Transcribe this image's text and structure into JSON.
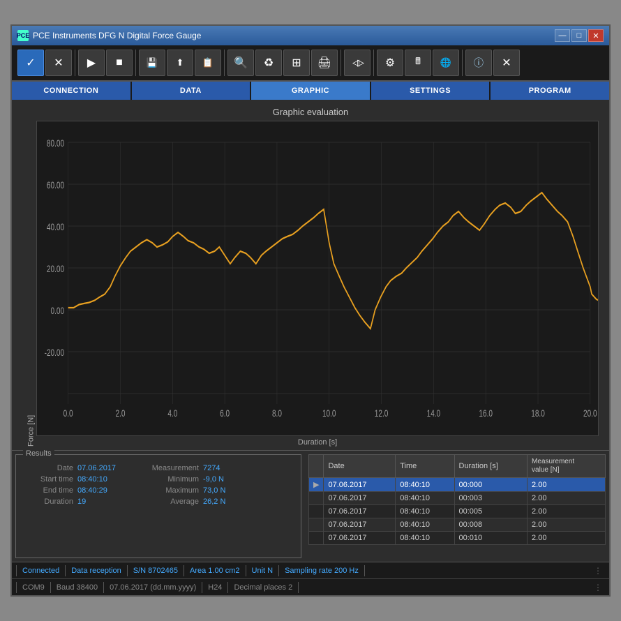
{
  "window": {
    "title": "PCE Instruments DFG N Digital Force Gauge",
    "controls": {
      "minimize": "—",
      "maximize": "□",
      "close": "✕"
    }
  },
  "toolbar": {
    "buttons": [
      {
        "name": "checkmark",
        "icon": "✓",
        "active": true
      },
      {
        "name": "cancel",
        "icon": "✕",
        "active": false
      },
      {
        "name": "play",
        "icon": "▶",
        "active": false
      },
      {
        "name": "stop",
        "icon": "■",
        "active": false
      },
      {
        "name": "save",
        "icon": "💾",
        "active": false
      },
      {
        "name": "export",
        "icon": "⬆",
        "active": false
      },
      {
        "name": "import",
        "icon": "📋",
        "active": false
      },
      {
        "name": "search",
        "icon": "🔍",
        "active": false
      },
      {
        "name": "refresh",
        "icon": "♻",
        "active": false
      },
      {
        "name": "grid",
        "icon": "⊞",
        "active": false
      },
      {
        "name": "print",
        "icon": "🖨",
        "active": false
      },
      {
        "name": "filter",
        "icon": "◁▷",
        "active": false
      },
      {
        "name": "settings",
        "icon": "⚙",
        "active": false
      },
      {
        "name": "calculator",
        "icon": "🖩",
        "active": false
      },
      {
        "name": "globe",
        "icon": "🌐",
        "active": false
      },
      {
        "name": "info",
        "icon": "ⓘ",
        "active": false
      },
      {
        "name": "close2",
        "icon": "✕",
        "active": false
      }
    ]
  },
  "nav": {
    "items": [
      {
        "label": "CONNECTION",
        "active": false
      },
      {
        "label": "DATA",
        "active": false
      },
      {
        "label": "GRAPHIC",
        "active": true
      },
      {
        "label": "SETTINGS",
        "active": false
      },
      {
        "label": "PROGRAM",
        "active": false
      }
    ]
  },
  "chart": {
    "title": "Graphic evaluation",
    "y_label": "Force [N]",
    "x_label": "Duration [s]",
    "y_ticks": [
      "80.00",
      "60.00",
      "40.00",
      "20.00",
      "0.00",
      "-20.00"
    ],
    "x_ticks": [
      "0.0",
      "2.0",
      "4.0",
      "6.0",
      "8.0",
      "10.0",
      "12.0",
      "14.0",
      "16.0",
      "18.0",
      "20.0"
    ]
  },
  "results": {
    "title": "Results",
    "date_label": "Date",
    "date_value": "07.06.2017",
    "measurement_label": "Measurement",
    "measurement_value": "7274",
    "start_label": "Start time",
    "start_value": "08:40:10",
    "minimum_label": "Minimum",
    "minimum_value": "-9,0 N",
    "end_label": "End time",
    "end_value": "08:40:29",
    "maximum_label": "Maximum",
    "maximum_value": "73,0 N",
    "duration_label": "Duration",
    "duration_value": "19",
    "average_label": "Average",
    "average_value": "26,2 N"
  },
  "table": {
    "headers": [
      "Date",
      "Time",
      "Duration [s]",
      "Measurement\nvalue [N]"
    ],
    "rows": [
      {
        "selected": true,
        "marker": "▶",
        "date": "07.06.2017",
        "time": "08:40:10",
        "duration": "00:000",
        "value": "2.00"
      },
      {
        "selected": false,
        "marker": "",
        "date": "07.06.2017",
        "time": "08:40:10",
        "duration": "00:003",
        "value": "2.00"
      },
      {
        "selected": false,
        "marker": "",
        "date": "07.06.2017",
        "time": "08:40:10",
        "duration": "00:005",
        "value": "2.00"
      },
      {
        "selected": false,
        "marker": "",
        "date": "07.06.2017",
        "time": "08:40:10",
        "duration": "00:008",
        "value": "2.00"
      },
      {
        "selected": false,
        "marker": "",
        "date": "07.06.2017",
        "time": "08:40:10",
        "duration": "00:010",
        "value": "2.00"
      }
    ]
  },
  "status1": {
    "items": [
      "Connected",
      "Data reception",
      "S/N 8702465",
      "Area 1.00 cm2",
      "Unit N",
      "Sampling rate 200 Hz"
    ]
  },
  "status2": {
    "items": [
      "COM9",
      "Baud 38400",
      "07.06.2017 (dd.mm.yyyy)",
      "H24",
      "Decimal places 2"
    ]
  }
}
